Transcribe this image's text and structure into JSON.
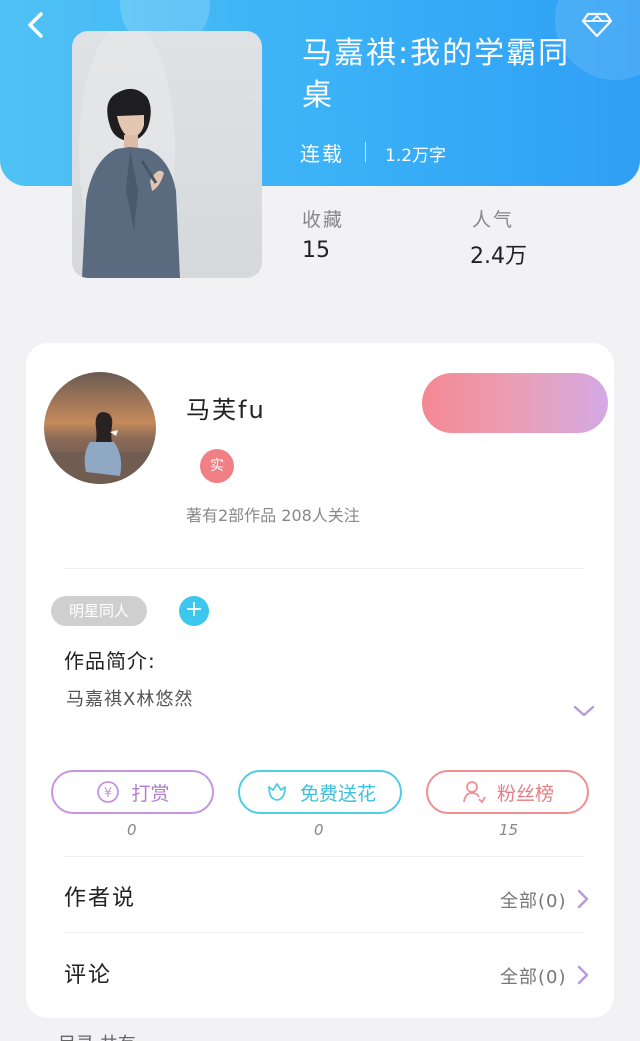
{
  "header": {
    "back_icon": "chevron-left-icon",
    "vip_icon": "diamond-icon",
    "title": "马嘉祺:我的学霸同桌",
    "status": "连载",
    "word_count": "1.2万字",
    "stats": [
      {
        "label": "收藏",
        "value": "15"
      },
      {
        "label": "人气",
        "value": "2.4万"
      }
    ]
  },
  "author": {
    "name": "马芙fu",
    "badge": "实",
    "meta": "著有2部作品 208人关注"
  },
  "intro": {
    "tag": "明星同人",
    "add_icon": "+",
    "label": "作品简介:",
    "text": "马嘉祺X林悠然"
  },
  "actions": [
    {
      "label": "打赏",
      "icon": "yen-coin-icon",
      "count": "0"
    },
    {
      "label": "免费送花",
      "icon": "flower-icon",
      "count": "0"
    },
    {
      "label": "粉丝榜",
      "icon": "fan-user-icon",
      "count": "15"
    }
  ],
  "rows": [
    {
      "label": "作者说",
      "value": "全部(0)"
    },
    {
      "label": "评论",
      "value": "全部(0)"
    }
  ],
  "bottom": {
    "text": "目录 共有"
  },
  "colors": {
    "header_start": "#4fc2f5",
    "header_end": "#2f9ff5",
    "accent_purple": "#c796e0",
    "accent_cyan": "#50cde6",
    "accent_pink": "#ef8f93",
    "badge_pink": "#f07f86"
  }
}
